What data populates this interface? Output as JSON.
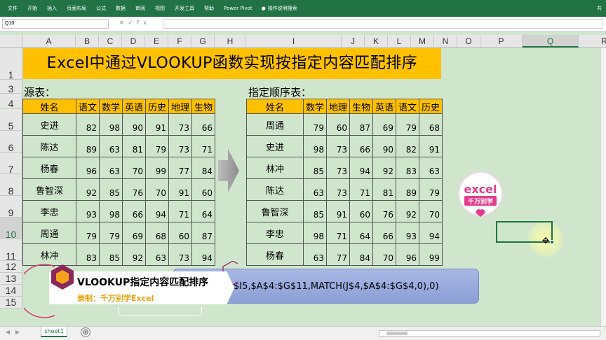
{
  "ribbon": {
    "tabs": [
      "文件",
      "开始",
      "插入",
      "页面布局",
      "公式",
      "数据",
      "审阅",
      "视图",
      "开发工具",
      "帮助",
      "Power Pivot"
    ],
    "search_label": "操作说明搜索",
    "share_label": "共"
  },
  "formula_bar": {
    "name_box": "Q10",
    "formula": ""
  },
  "columns": [
    "A",
    "B",
    "C",
    "D",
    "E",
    "F",
    "G",
    "H",
    "I",
    "J",
    "K",
    "L",
    "M",
    "N",
    "O",
    "P",
    "Q",
    "R"
  ],
  "selected_column": "Q",
  "rows": [
    "1",
    "3",
    "4",
    "5",
    "6",
    "7",
    "8",
    "9",
    "10",
    "11",
    "12",
    "13",
    "14",
    "15"
  ],
  "selected_row": "10",
  "title": "Excel中通过VLOOKUP函数实现按指定内容匹配排序",
  "source_label": "源表：",
  "target_label": "指定顺序表：",
  "source_table": {
    "headers": [
      "姓名",
      "语文",
      "数学",
      "英语",
      "历史",
      "地理",
      "生物"
    ],
    "rows": [
      [
        "史进",
        "82",
        "98",
        "90",
        "91",
        "73",
        "66"
      ],
      [
        "陈达",
        "89",
        "63",
        "81",
        "79",
        "73",
        "71"
      ],
      [
        "杨春",
        "96",
        "63",
        "70",
        "99",
        "77",
        "84"
      ],
      [
        "鲁智深",
        "92",
        "85",
        "76",
        "70",
        "91",
        "60"
      ],
      [
        "李忠",
        "93",
        "98",
        "66",
        "94",
        "71",
        "64"
      ],
      [
        "周通",
        "79",
        "79",
        "69",
        "68",
        "60",
        "87"
      ],
      [
        "林冲",
        "83",
        "85",
        "92",
        "63",
        "73",
        "94"
      ]
    ]
  },
  "target_table": {
    "headers": [
      "姓名",
      "数学",
      "地理",
      "生物",
      "英语",
      "语文",
      "历史"
    ],
    "rows": [
      [
        "周通",
        "79",
        "60",
        "87",
        "69",
        "79",
        "68"
      ],
      [
        "史进",
        "98",
        "73",
        "66",
        "90",
        "82",
        "91"
      ],
      [
        "林冲",
        "85",
        "73",
        "94",
        "92",
        "83",
        "63"
      ],
      [
        "陈达",
        "63",
        "73",
        "71",
        "81",
        "89",
        "79"
      ],
      [
        "鲁智深",
        "85",
        "91",
        "60",
        "76",
        "92",
        "70"
      ],
      [
        "李忠",
        "98",
        "71",
        "64",
        "66",
        "93",
        "94"
      ],
      [
        "杨春",
        "63",
        "77",
        "84",
        "70",
        "96",
        "99"
      ]
    ]
  },
  "formula_display": "$I5,$A$4:$G$11,MATCH(J$4,$A$4:$G$4,0),0)",
  "banner": {
    "title": "VLOOKUP指定内容匹配排序",
    "subtitle": "录制：千万别学Excel"
  },
  "logo": {
    "line1": "excel",
    "line2": "千万别学"
  },
  "sheet_tab": "sheet1",
  "add_sheet": "⊕",
  "colors": {
    "accent": "#217346",
    "header_fill": "#ffc000",
    "sheet_bg": "#cfe6cd",
    "formula_box": "#9aaade",
    "brand_pink": "#e23c8a"
  }
}
